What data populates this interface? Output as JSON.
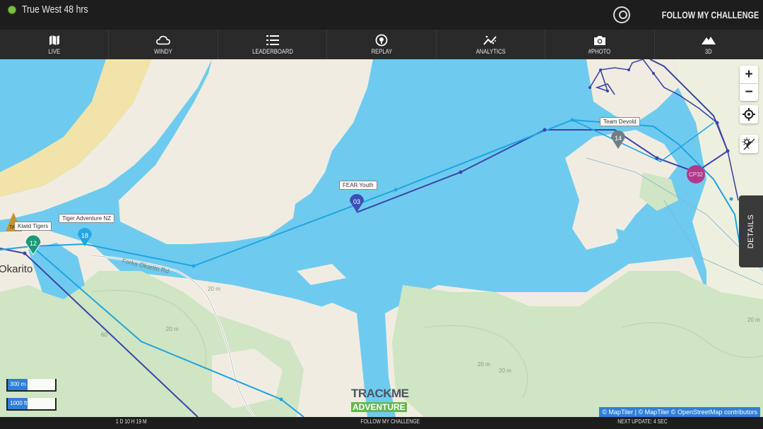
{
  "header": {
    "event_title": "True West 48 hrs",
    "brand_prefix": "FOLLOW ",
    "brand_suffix": "MY CHALLENGE",
    "status_color": "#7bc043"
  },
  "nav": {
    "items": [
      {
        "label": "LIVE",
        "icon": "map-icon"
      },
      {
        "label": "WINDY",
        "icon": "cloud-icon"
      },
      {
        "label": "LEADERBOARD",
        "icon": "list-icon"
      },
      {
        "label": "REPLAY",
        "icon": "replay-pin-icon"
      },
      {
        "label": "ANALYTICS",
        "icon": "analytics-icon"
      },
      {
        "label": "#PHOTO",
        "icon": "camera-icon"
      },
      {
        "label": "3D",
        "icon": "mountain-icon"
      }
    ]
  },
  "map": {
    "place": "Okarito",
    "road": "Forks Okarito Rd",
    "contours": [
      "20 m",
      "20 m",
      "60",
      "20 m",
      "20 m",
      "20 m"
    ],
    "markers": [
      {
        "number": "03",
        "team": "FEAR Youth",
        "color": "#3a4fb8"
      },
      {
        "number": "14",
        "team": "Team Devold",
        "color": "#6f7e86"
      },
      {
        "number": "18",
        "team": "Tiger Adventure NZ",
        "color": "#22a8e6"
      },
      {
        "number": "12",
        "team": "",
        "color": "#1a9a7a"
      },
      {
        "number": "TA2",
        "team": "Kiwid Tigers",
        "color": "#c9922e"
      },
      {
        "number": "CP32",
        "team": "",
        "color": "#b03a8a"
      }
    ],
    "controls": {
      "zoom_in": "+",
      "zoom_out": "−"
    },
    "details_label": "DETAILS",
    "scale": {
      "metric": "300 m",
      "imperial": "1000 ft"
    },
    "logo": {
      "line1": "TRACKME",
      "line2": "ADVENTURE"
    },
    "attribution": "© MapTiler | © MapTiler © OpenStreetMap contributors",
    "colors": {
      "water": "#6ecbef",
      "land": "#f1ece1",
      "forest": "#cfe5c3",
      "track_dark": "#3b44a8",
      "track_light": "#1fa4e0"
    }
  },
  "footer": {
    "elapsed": "1 D 10 H 19 M",
    "center": "FOLLOW MY CHALLENGE",
    "next_update": "NEXT UPDATE: 4 SEC"
  }
}
